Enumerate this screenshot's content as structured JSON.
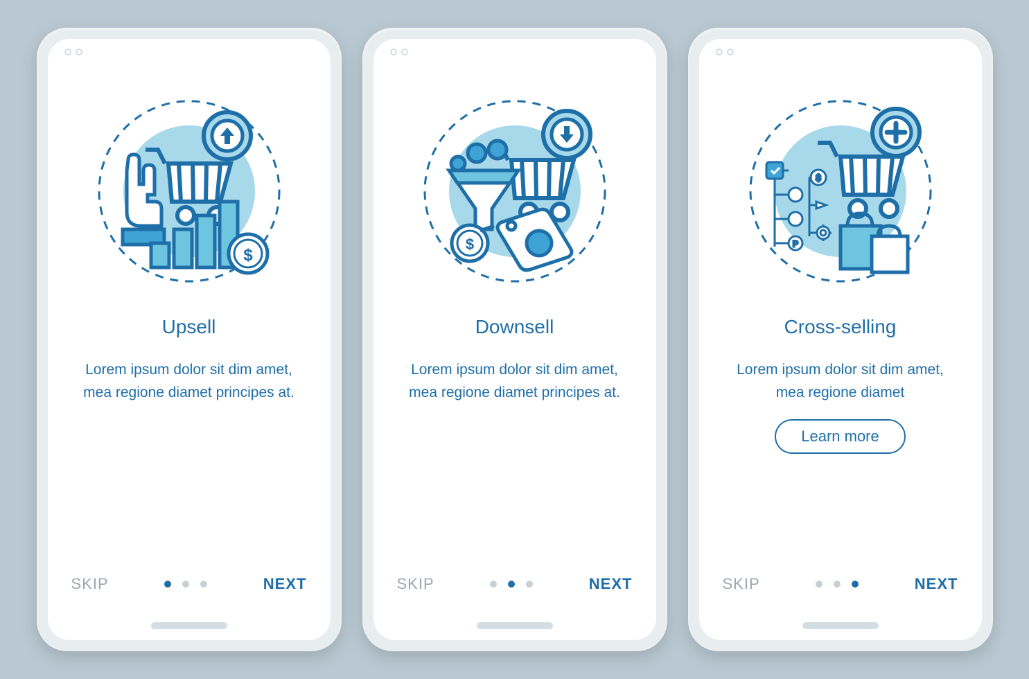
{
  "screens": [
    {
      "title": "Upsell",
      "description": "Lorem ipsum dolor sit dim amet, mea regione diamet principes at.",
      "skip": "SKIP",
      "next": "NEXT",
      "activeDot": 0,
      "hasLearnMore": false
    },
    {
      "title": "Downsell",
      "description": "Lorem ipsum dolor sit dim amet, mea regione diamet principes at.",
      "skip": "SKIP",
      "next": "NEXT",
      "activeDot": 1,
      "hasLearnMore": false
    },
    {
      "title": "Cross-selling",
      "description": "Lorem ipsum dolor sit dim amet, mea regione diamet",
      "skip": "SKIP",
      "next": "NEXT",
      "activeDot": 2,
      "hasLearnMore": true,
      "learnMore": "Learn more"
    }
  ],
  "colors": {
    "primary": "#1e6ea8",
    "accent": "#6ec5e0",
    "muted": "#9aa7af",
    "bg": "#b9c8d2"
  }
}
